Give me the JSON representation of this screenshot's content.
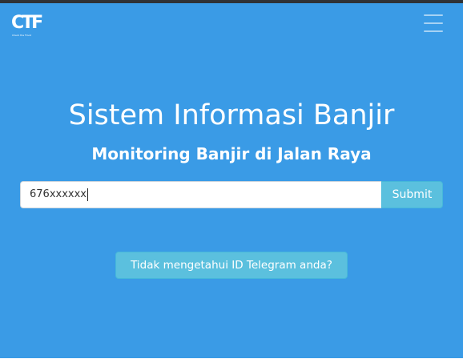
{
  "header": {
    "logo_text": "CTF",
    "logo_tagline": "Check the Flood",
    "menu_icon": "hamburger-icon"
  },
  "hero": {
    "title": "Sistem Informasi Banjir",
    "subtitle": "Monitoring Banjir di Jalan Raya"
  },
  "form": {
    "input_value": "676xxxxxx",
    "submit_label": "Submit"
  },
  "help_button_label": "Tidak mengetahui ID Telegram anda?",
  "colors": {
    "background": "#3a9be6",
    "button": "#5bc0de",
    "text": "#ffffff"
  }
}
